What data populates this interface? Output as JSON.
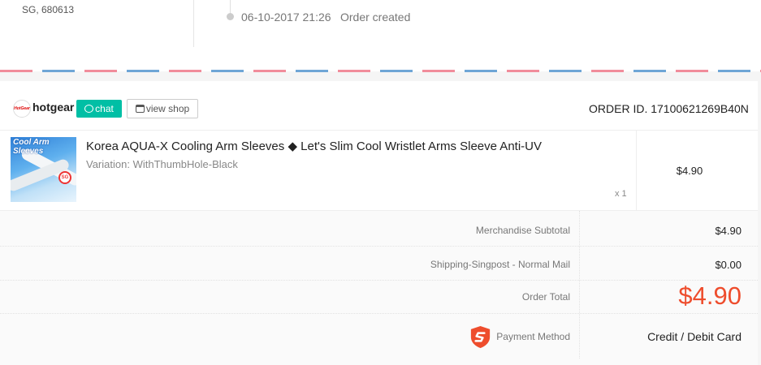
{
  "address": {
    "line": "SG, 680613"
  },
  "timeline": {
    "date": "06-10-2017 21:26",
    "event": "Order created"
  },
  "shop": {
    "logo_text": "HotGear",
    "name": "hotgear",
    "chat_label": "chat",
    "view_shop_label": "view shop",
    "order_id": "ORDER ID. 17100621269B40N"
  },
  "product": {
    "image_caption": "Cool Arm Sleeves",
    "image_badge": "SG",
    "title": "Korea AQUA-X Cooling Arm Sleeves ◆ Let's Slim Cool Wristlet Arms Sleeve Anti-UV",
    "variation": "Variation: WithThumbHole-Black",
    "quantity": "x 1",
    "price": "$4.90"
  },
  "summary": {
    "subtotal_label": "Merchandise Subtotal",
    "subtotal_value": "$4.90",
    "shipping_label": "Shipping-Singpost - Normal Mail",
    "shipping_value": "$0.00",
    "total_label": "Order Total",
    "total_value": "$4.90",
    "payment_label": "Payment Method",
    "payment_value": "Credit / Debit Card"
  },
  "colors": {
    "accent": "#ee4d2d",
    "chat": "#00bfa5",
    "airmail_red": "#f18d9b",
    "airmail_blue": "#6fa6d6"
  },
  "icons": {
    "chat": "chat-bubble-icon",
    "shop": "store-icon",
    "payment": "shield-icon"
  }
}
